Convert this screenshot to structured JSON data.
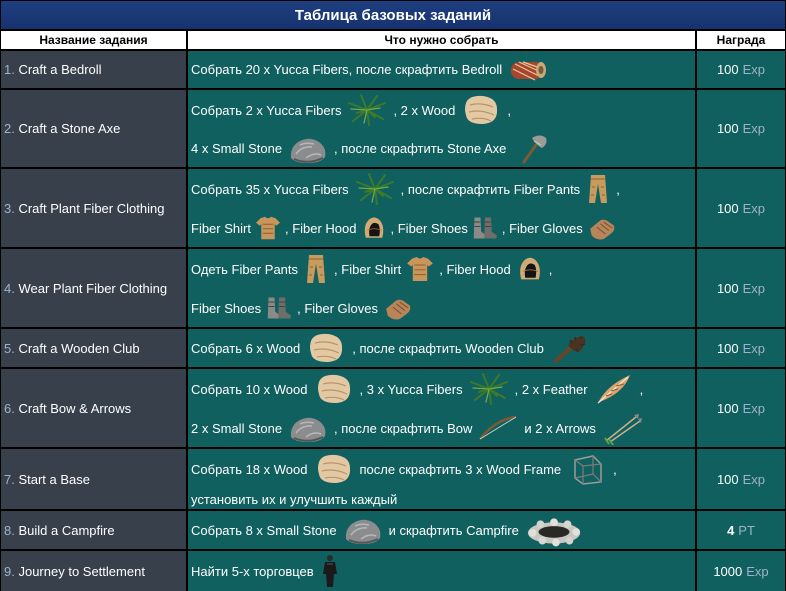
{
  "title": "Таблица базовых заданий",
  "headers": {
    "name": "Название задания",
    "task": "Что нужно собрать",
    "reward": "Награда"
  },
  "rows": [
    {
      "num": "1.",
      "name": "Craft a Bedroll",
      "t": [
        "Собрать 20 x Yucca Fibers, после скрафтить Bedroll"
      ],
      "rv": "100",
      "ru": "Exp"
    },
    {
      "num": "2.",
      "name": "Craft a Stone Axe",
      "t": [
        "Собрать 2 x Yucca Fibers",
        ", 2 x Wood",
        ",",
        "4 x Small Stone",
        ", после скрафтить Stone Axe"
      ],
      "rv": "100",
      "ru": "Exp"
    },
    {
      "num": "3.",
      "name": "Craft Plant Fiber Clothing",
      "t": [
        "Собрать 35 x Yucca Fibers",
        ", после скрафтить Fiber Pants",
        ",",
        "Fiber Shirt",
        ", Fiber Hood",
        ", Fiber Shoes",
        ", Fiber Gloves"
      ],
      "rv": "100",
      "ru": "Exp"
    },
    {
      "num": "4.",
      "name": "Wear Plant Fiber Clothing",
      "t": [
        "Одеть Fiber Pants",
        ", Fiber Shirt",
        ", Fiber Hood",
        ",",
        "Fiber Shoes",
        ", Fiber Gloves"
      ],
      "rv": "100",
      "ru": "Exp"
    },
    {
      "num": "5.",
      "name": "Craft a Wooden Club",
      "t": [
        "Собрать 6 x Wood",
        ", после скрафтить Wooden Club"
      ],
      "rv": "100",
      "ru": "Exp"
    },
    {
      "num": "6.",
      "name": "Craft Bow & Arrows",
      "t": [
        "Собрать 10 x Wood",
        ", 3 x Yucca Fibers",
        ", 2 x Feather",
        ",",
        "2 x Small Stone",
        ", после скрафтить Bow",
        "и 2 x Arrows"
      ],
      "rv": "100",
      "ru": "Exp"
    },
    {
      "num": "7.",
      "name": "Start a Base",
      "t": [
        "Собрать 18 x Wood",
        "после скрафтить 3 x Wood Frame",
        ",",
        "установить их и улучшить каждый"
      ],
      "rv": "100",
      "ru": "Exp"
    },
    {
      "num": "8.",
      "name": "Build a Campfire",
      "t": [
        "Собрать 8 x Small Stone",
        "и скрафтить Campfire"
      ],
      "rv": "4",
      "ru": "PT"
    },
    {
      "num": "9.",
      "name": "Journey to Settlement",
      "t": [
        "Найти 5-х торговцев"
      ],
      "rv": "1000",
      "ru": "Exp"
    }
  ],
  "icons": [
    "bedroll-icon",
    "yucca-fibers-icon",
    "wood-icon",
    "small-stone-icon",
    "stone-axe-icon",
    "fiber-pants-icon",
    "fiber-shirt-icon",
    "fiber-hood-icon",
    "fiber-shoes-icon",
    "fiber-gloves-icon",
    "wooden-club-icon",
    "feather-icon",
    "bow-icon",
    "arrows-icon",
    "wood-frame-icon",
    "campfire-icon",
    "trader-icon"
  ]
}
